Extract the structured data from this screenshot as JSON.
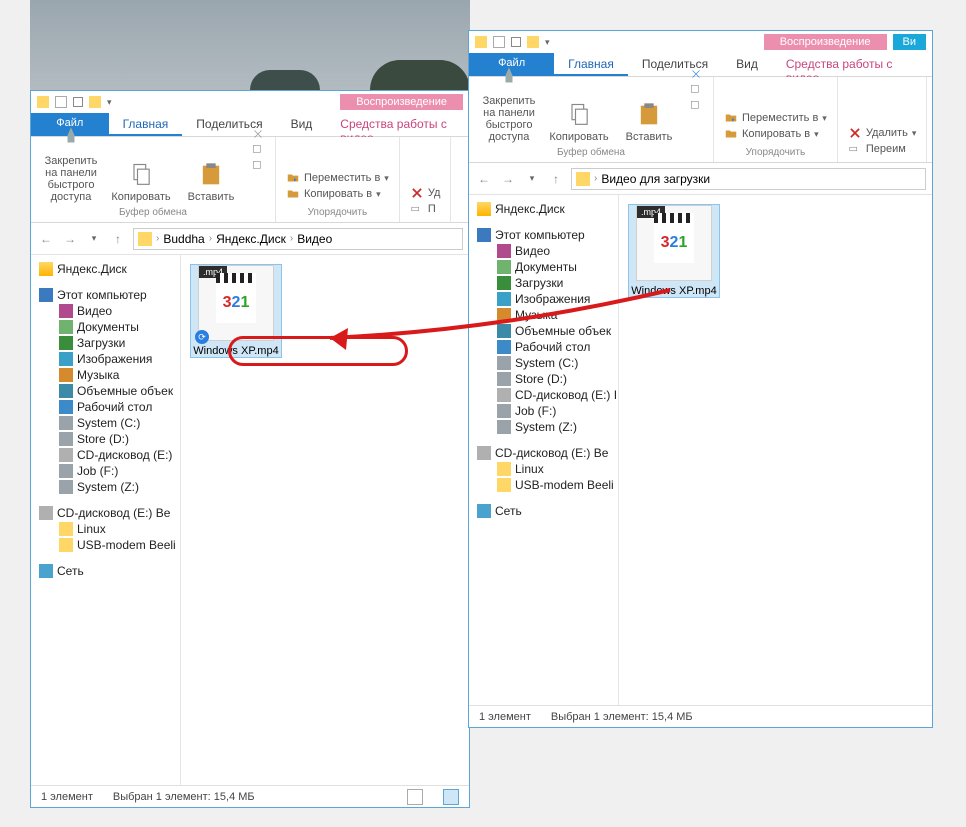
{
  "context_tab": "Воспроизведение",
  "context_tab2": "Ви",
  "tabs": {
    "file": "Файл",
    "home": "Главная",
    "share": "Поделиться",
    "view": "Вид",
    "tools": "Средства работы с видео"
  },
  "ribbon": {
    "pin": "Закрепить на панели\nбыстрого доступа",
    "copy": "Копировать",
    "paste": "Вставить",
    "group_clipboard": "Буфер обмена",
    "move_to": "Переместить в",
    "copy_to": "Копировать в",
    "delete": "Удалить",
    "rename": "Переим",
    "group_organize": "Упорядочить"
  },
  "win1": {
    "breadcrumb": [
      "Buddha",
      "Яндекс.Диск",
      "Видео"
    ],
    "file": {
      "ext": ".mp4",
      "name": "Windows XP.mp4"
    },
    "status": {
      "count": "1 элемент",
      "sel": "Выбран 1 элемент: 15,4 МБ"
    }
  },
  "win2": {
    "breadcrumb_folder": "Видео для загрузки",
    "file": {
      "ext": ".mp4",
      "name": "Windows XP.mp4"
    },
    "status": {
      "count": "1 элемент",
      "sel": "Выбран 1 элемент: 15,4 МБ"
    }
  },
  "tree_a": [
    {
      "label": "Яндекс.Диск",
      "icon": "yd",
      "lvl": 1,
      "root": true
    },
    {
      "spacer": true
    },
    {
      "label": "Этот компьютер",
      "icon": "pc",
      "lvl": 1,
      "root": true
    },
    {
      "label": "Видео",
      "icon": "vid",
      "lvl": 2
    },
    {
      "label": "Документы",
      "icon": "doc",
      "lvl": 2
    },
    {
      "label": "Загрузки",
      "icon": "dl",
      "lvl": 2
    },
    {
      "label": "Изображения",
      "icon": "img",
      "lvl": 2
    },
    {
      "label": "Музыка",
      "icon": "mus",
      "lvl": 2
    },
    {
      "label": "Объемные объек",
      "icon": "3d",
      "lvl": 2
    },
    {
      "label": "Рабочий стол",
      "icon": "desk",
      "lvl": 2
    },
    {
      "label": "System (C:)",
      "icon": "drv",
      "lvl": 2
    },
    {
      "label": "Store (D:)",
      "icon": "drv",
      "lvl": 2
    },
    {
      "label": "CD-дисковод (E:)",
      "icon": "cd",
      "lvl": 2
    },
    {
      "label": "Job (F:)",
      "icon": "drv",
      "lvl": 2
    },
    {
      "label": "System (Z:)",
      "icon": "drv",
      "lvl": 2
    },
    {
      "spacer": true
    },
    {
      "label": "CD-дисковод (E:) Be",
      "icon": "cd",
      "lvl": 1,
      "root": true
    },
    {
      "label": "Linux",
      "icon": "folder",
      "lvl": 2
    },
    {
      "label": "USB-modem Beeli",
      "icon": "folder",
      "lvl": 2
    },
    {
      "spacer": true
    },
    {
      "label": "Сеть",
      "icon": "net",
      "lvl": 1,
      "root": true
    }
  ],
  "tree_b": [
    {
      "label": "Яндекс.Диск",
      "icon": "yd",
      "lvl": 1,
      "root": true
    },
    {
      "spacer": true
    },
    {
      "label": "Этот компьютер",
      "icon": "pc",
      "lvl": 1,
      "root": true
    },
    {
      "label": "Видео",
      "icon": "vid",
      "lvl": 2
    },
    {
      "label": "Документы",
      "icon": "doc",
      "lvl": 2
    },
    {
      "label": "Загрузки",
      "icon": "dl",
      "lvl": 2
    },
    {
      "label": "Изображения",
      "icon": "img",
      "lvl": 2
    },
    {
      "label": "Музыка",
      "icon": "mus",
      "lvl": 2
    },
    {
      "label": "Объемные объек",
      "icon": "3d",
      "lvl": 2
    },
    {
      "label": "Рабочий стол",
      "icon": "desk",
      "lvl": 2
    },
    {
      "label": "System (C:)",
      "icon": "drv",
      "lvl": 2
    },
    {
      "label": "Store (D:)",
      "icon": "drv",
      "lvl": 2
    },
    {
      "label": "CD-дисковод (E:) I",
      "icon": "cd",
      "lvl": 2
    },
    {
      "label": "Job (F:)",
      "icon": "drv",
      "lvl": 2
    },
    {
      "label": "System (Z:)",
      "icon": "drv",
      "lvl": 2
    },
    {
      "spacer": true
    },
    {
      "label": "CD-дисковод (E:) Be",
      "icon": "cd",
      "lvl": 1,
      "root": true
    },
    {
      "label": "Linux",
      "icon": "folder",
      "lvl": 2
    },
    {
      "label": "USB-modem Beeli",
      "icon": "folder",
      "lvl": 2
    },
    {
      "spacer": true
    },
    {
      "label": "Сеть",
      "icon": "net",
      "lvl": 1,
      "root": true
    }
  ]
}
